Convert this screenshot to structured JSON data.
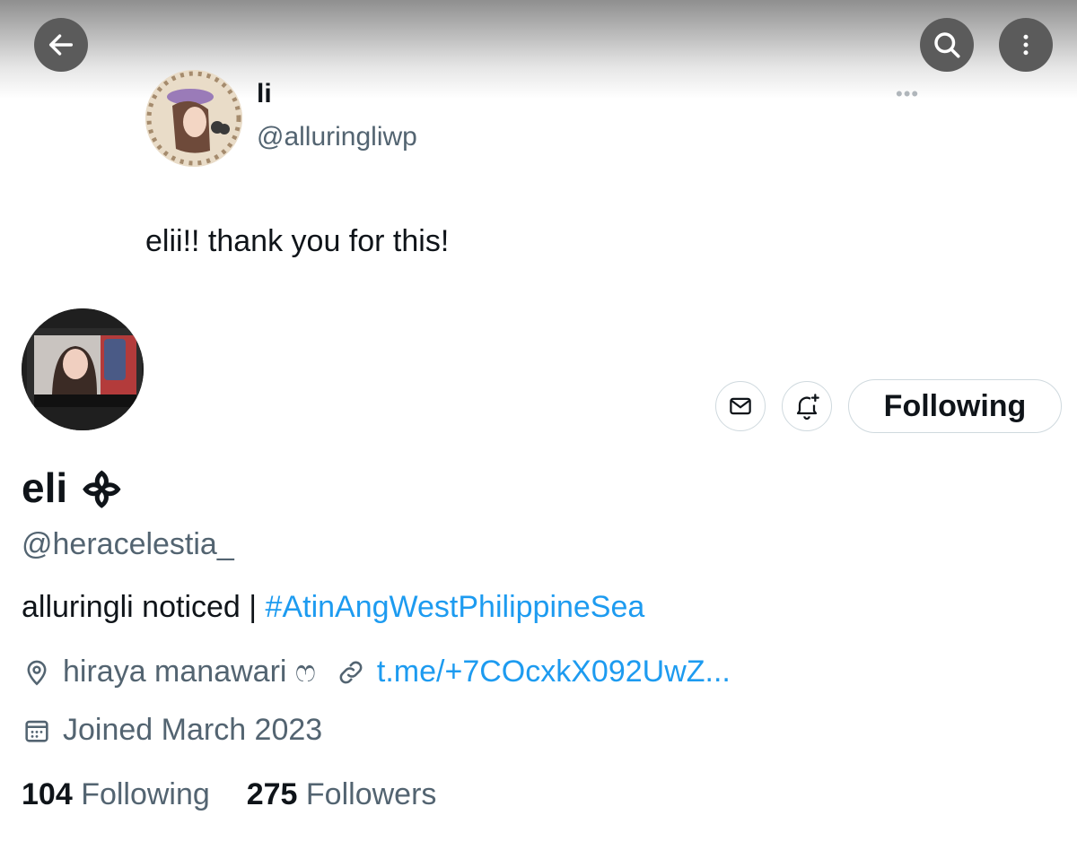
{
  "tweet": {
    "name": "li",
    "handle": "@alluringliwp",
    "more": "•••",
    "text": "elii!! thank you for this!"
  },
  "profile": {
    "display_name": "eli ᯽",
    "handle": "@heracelestia_",
    "bio_text": "alluringli noticed | ",
    "bio_hashtag": "#AtinAngWestPhilippineSea",
    "location": "hiraya manawari ෆ",
    "link": "t.me/+7COcxkX092UwZ...",
    "joined": "Joined March 2023",
    "follow_button": "Following",
    "following_count": "104",
    "following_label": "Following",
    "followers_count": "275",
    "followers_label": "Followers"
  },
  "icons": {
    "back": "arrow-left-icon",
    "search": "search-icon",
    "more": "more-vertical-icon",
    "dm": "envelope-icon",
    "notify": "bell-plus-icon",
    "location": "location-pin-icon",
    "link": "link-icon",
    "calendar": "calendar-icon"
  }
}
